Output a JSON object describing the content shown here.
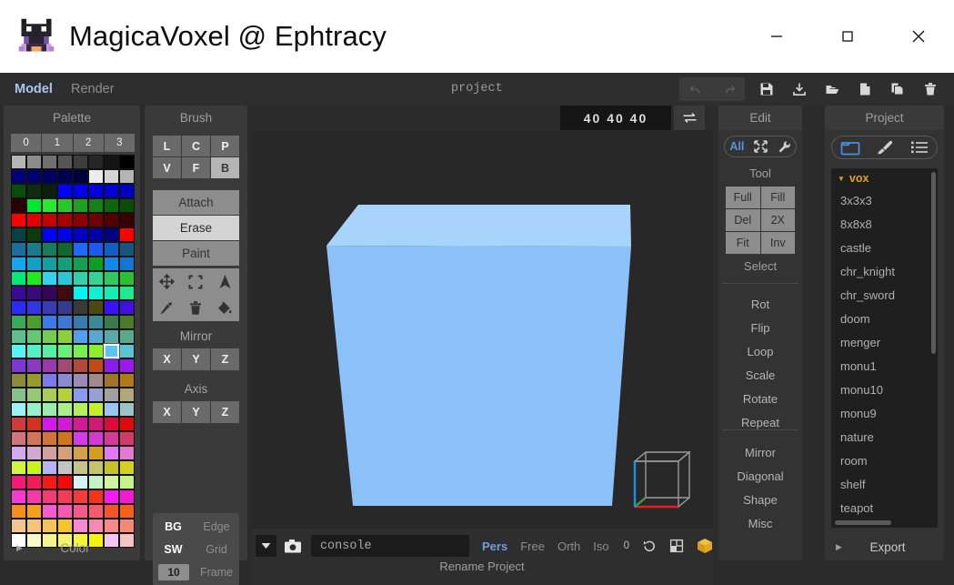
{
  "window": {
    "title": "MagicaVoxel @ Ephtracy",
    "controls": [
      {
        "name": "minimize-button",
        "glyph": "minimize"
      },
      {
        "name": "maximize-button",
        "glyph": "maximize"
      },
      {
        "name": "close-button",
        "glyph": "close"
      }
    ]
  },
  "menubar": {
    "tabs": [
      {
        "label": "Model",
        "active": true
      },
      {
        "label": "Render",
        "active": false
      }
    ],
    "project_label": "project",
    "toolbar_icons": [
      {
        "name": "undo-icon",
        "disabled": true
      },
      {
        "name": "redo-icon",
        "disabled": true
      },
      {
        "name": "save-icon",
        "disabled": false
      },
      {
        "name": "download-icon",
        "disabled": false
      },
      {
        "name": "open-folder-icon",
        "disabled": false
      },
      {
        "name": "new-file-icon",
        "disabled": false
      },
      {
        "name": "copy-icon",
        "disabled": false
      },
      {
        "name": "delete-icon",
        "disabled": false
      }
    ]
  },
  "size_field": {
    "value": "40  40  40"
  },
  "palette": {
    "header": "Palette",
    "columns": [
      "0",
      "1",
      "2",
      "3"
    ],
    "footer": "Color",
    "selected_index": 110,
    "colors": [
      "#b4b4b4",
      "#8c8c8c",
      "#707070",
      "#555555",
      "#3d3d3d",
      "#262626",
      "#141414",
      "#000000",
      "#00007e",
      "#000070",
      "#000062",
      "#000050",
      "#00003c",
      "#ececec",
      "#d4d4d4",
      "#b4b4b4",
      "#074c07",
      "#0d2d0d",
      "#0a200a",
      "#0000ff",
      "#0000f0",
      "#0000e0",
      "#0000d2",
      "#0000c4",
      "#2a0000",
      "#00e830",
      "#2ae830",
      "#28c828",
      "#1f9e1f",
      "#158015",
      "#0d660d",
      "#0a4d0a",
      "#ff0000",
      "#e00000",
      "#c40000",
      "#a60000",
      "#8c0000",
      "#700000",
      "#540000",
      "#3a0000",
      "#0a4040",
      "#0c3a0c",
      "#0000ff",
      "#0000ec",
      "#0000c8",
      "#0000a6",
      "#000080",
      "#ff0000",
      "#1a6e9e",
      "#1a7a8a",
      "#1a7a5c",
      "#0d6a2a",
      "#1a6aff",
      "#1a5aec",
      "#1060c4",
      "#15557e",
      "#12a8f0",
      "#12a0c8",
      "#14a0a0",
      "#10a07a",
      "#12a050",
      "#0c9e20",
      "#1288ec",
      "#1276d2",
      "#00e878",
      "#22ea22",
      "#32d2f0",
      "#2ac8d2",
      "#30d0a8",
      "#34d294",
      "#30c860",
      "#2cc030",
      "#3a0a96",
      "#3a0a7a",
      "#36045c",
      "#420a0a",
      "#00f4f4",
      "#12f0d2",
      "#14eeb0",
      "#18ec8e",
      "#2a2aff",
      "#3434e0",
      "#3a3ab4",
      "#3a3a8c",
      "#3a3a3a",
      "#4a4a10",
      "#3a10ff",
      "#4010e0",
      "#3aa85c",
      "#4aa02a",
      "#3a7aec",
      "#3a7ad2",
      "#3a7aa8",
      "#3a8a96",
      "#3a7a4a",
      "#4a7a2a",
      "#5cc08c",
      "#62c874",
      "#76cc52",
      "#8ad03a",
      "#52a0ec",
      "#5aa8d2",
      "#5aa8a8",
      "#5aa88c",
      "#52f4f4",
      "#52f0c8",
      "#56eea0",
      "#6aee7a",
      "#7aee50",
      "#8aee2a",
      "#5ac4f4",
      "#5ac4d2",
      "#7a3ad2",
      "#8a3ac0",
      "#9a3aa8",
      "#a04a74",
      "#b04a3a",
      "#c04a1a",
      "#8a1aee",
      "#9a1aee",
      "#8a8a3a",
      "#9a9a2a",
      "#7a7aec",
      "#8a8ad2",
      "#9a8ab4",
      "#a08a8a",
      "#a0742a",
      "#b07a1a",
      "#8ac08a",
      "#96c878",
      "#a8cc5a",
      "#b4d03a",
      "#8a9aec",
      "#96a0d2",
      "#a0a0a0",
      "#b0a878",
      "#9af4f4",
      "#96f0c8",
      "#9aeeaa",
      "#aaee8a",
      "#b4ee5a",
      "#c4ee2a",
      "#9ac4f4",
      "#9ac4c8",
      "#d23a3a",
      "#d2341a",
      "#d21af0",
      "#d21ad2",
      "#d21a96",
      "#d21a74",
      "#e00a3a",
      "#e00a0a",
      "#d2747a",
      "#d2745a",
      "#d2743a",
      "#d2741a",
      "#d23af0",
      "#d23ad2",
      "#d23a96",
      "#d23a6a",
      "#d2a8f4",
      "#d2a8d2",
      "#d2a0a0",
      "#d2a07a",
      "#d2a04a",
      "#d2a01a",
      "#e07af4",
      "#e07ad2",
      "#d2f43a",
      "#c8f41a",
      "#b4b4f4",
      "#c4c4c4",
      "#c4c48a",
      "#c4c46a",
      "#c4c42a",
      "#d2d21a",
      "#f41a74",
      "#f41a5a",
      "#f41a1a",
      "#f40a0a",
      "#d2f4f4",
      "#c4f4c4",
      "#d2f4a0",
      "#c4f48a",
      "#f43ad2",
      "#f43aa8",
      "#f43a74",
      "#f43a5a",
      "#f43a3a",
      "#f4341a",
      "#f41af4",
      "#f41ad2",
      "#f4901a",
      "#f4a01a",
      "#f45ad2",
      "#f45ab4",
      "#f45a8a",
      "#f45a6a",
      "#f4542a",
      "#f4601a",
      "#f4c490",
      "#f4c47a",
      "#f4c45a",
      "#f4c42a",
      "#f48ad2",
      "#f48ab4",
      "#f48a8a",
      "#f48a74",
      "#ffffff",
      "#f8f8c8",
      "#f4f490",
      "#f4f46a",
      "#f4f43a",
      "#f4f40a",
      "#f4c4f4",
      "#f4c4c4"
    ]
  },
  "brush": {
    "header": "Brush",
    "shape_row1": [
      {
        "label": "L",
        "active": false
      },
      {
        "label": "C",
        "active": false
      },
      {
        "label": "P",
        "active": false
      }
    ],
    "shape_row2": [
      {
        "label": "V",
        "active": false
      },
      {
        "label": "F",
        "active": false
      },
      {
        "label": "B",
        "active": true
      }
    ],
    "modes": [
      {
        "label": "Attach",
        "active": false
      },
      {
        "label": "Erase",
        "active": true
      },
      {
        "label": "Paint",
        "active": false
      }
    ],
    "tool_icons": [
      {
        "name": "move-icon"
      },
      {
        "name": "marquee-select-icon"
      },
      {
        "name": "cursor-icon"
      },
      {
        "name": "eyedropper-icon"
      },
      {
        "name": "trash-icon"
      },
      {
        "name": "paint-bucket-icon"
      }
    ],
    "mirror_label": "Mirror",
    "mirror_axes": [
      "X",
      "Y",
      "Z"
    ],
    "axis_label": "Axis",
    "axis_axes": [
      "X",
      "Y",
      "Z"
    ],
    "display_rows": [
      {
        "key": "BG",
        "value": "Edge"
      },
      {
        "key": "SW",
        "value": "Grid"
      },
      {
        "key": "10",
        "value": "Frame",
        "is_number": true
      }
    ]
  },
  "viewport": {
    "cube": {
      "top_face_color": "#a8d4fb",
      "front_face_color": "#8cc0f8",
      "background": "#282828"
    },
    "gizmo": {
      "x_axis_color": "#e02020",
      "y_axis_color": "#40a040",
      "z_axis_color": "#2090e0",
      "wire_color": "#9a9a9a"
    }
  },
  "statusbar": {
    "dropdown_icon": "chevron-down-icon",
    "camera_icon": "camera-icon",
    "console_value": "console",
    "view_modes": [
      {
        "label": "Pers",
        "active": true
      },
      {
        "label": "Free",
        "active": false
      },
      {
        "label": "Orth",
        "active": false
      },
      {
        "label": "Iso",
        "active": false
      }
    ],
    "angle_value": "0",
    "icons": [
      {
        "name": "rotate-icon"
      },
      {
        "name": "grid-steps-icon"
      },
      {
        "name": "voxel-box-icon",
        "color": "#e8a820"
      }
    ],
    "rename_label": "Rename Project"
  },
  "edit": {
    "header": "Edit",
    "segments": [
      {
        "label": "All",
        "name": "filter-all",
        "active": true
      },
      {
        "label": "",
        "name": "transform-icon",
        "active": false
      },
      {
        "label": "",
        "name": "wrench-icon",
        "active": false
      }
    ],
    "tool_label": "Tool",
    "tool_buttons": [
      "Full",
      "Fill",
      "Del",
      "2X",
      "Fit",
      "Inv"
    ],
    "select_label": "Select",
    "transform_items": [
      "Rot",
      "Flip",
      "Loop",
      "Scale",
      "Rotate",
      "Repeat"
    ],
    "extra_items": [
      "Mirror",
      "Diagonal",
      "Shape",
      "Misc"
    ]
  },
  "project": {
    "header": "Project",
    "segments": [
      {
        "name": "folder-icon",
        "active": true
      },
      {
        "name": "brush-icon",
        "active": false
      },
      {
        "name": "list-icon",
        "active": false
      }
    ],
    "root": "vox",
    "files": [
      "3x3x3",
      "8x8x8",
      "castle",
      "chr_knight",
      "chr_sword",
      "doom",
      "menger",
      "monu1",
      "monu10",
      "monu9",
      "nature",
      "room",
      "shelf",
      "teapot"
    ],
    "export_label": "Export"
  }
}
